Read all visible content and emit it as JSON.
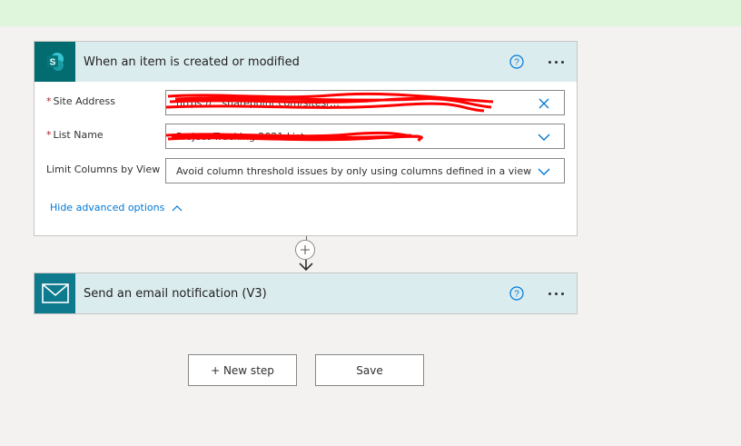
{
  "trigger_card": {
    "title": "When an item is created or modified",
    "icon": "sharepoint-icon",
    "icon_letter": "S",
    "fields": {
      "site_address": {
        "label": "Site Address",
        "required": true,
        "value": "https://…sharepoint.com/sites/…"
      },
      "list_name": {
        "label": "List Name",
        "required": true,
        "value": "Project Tracking 2021 List"
      },
      "limit_columns": {
        "label": "Limit Columns by View",
        "required": false,
        "value": "Avoid column threshold issues by only using columns defined in a view"
      }
    },
    "advanced_link": "Hide advanced options"
  },
  "action_card": {
    "title": "Send an email notification (V3)",
    "icon": "mail-icon"
  },
  "buttons": {
    "new_step": "+ New step",
    "save": "Save"
  },
  "colors": {
    "sharepoint": "#036c70",
    "mail": "#0e7a8e",
    "header_bg": "#dbecef",
    "accent": "#0078d4",
    "required": "#a4262c",
    "redaction": "#ff0000"
  }
}
